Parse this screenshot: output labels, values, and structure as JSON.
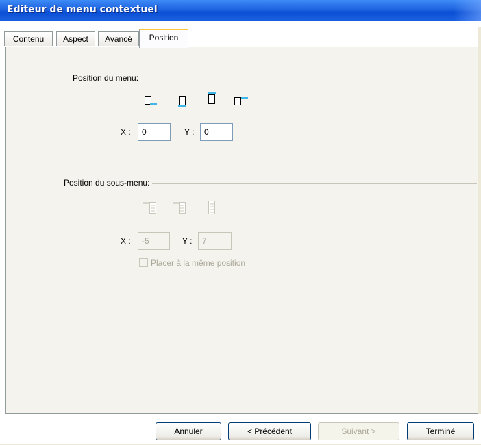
{
  "window": {
    "title": "Editeur de menu contextuel"
  },
  "tabs": [
    {
      "label": "Contenu"
    },
    {
      "label": "Aspect"
    },
    {
      "label": "Avancé"
    },
    {
      "label": "Position",
      "active": true
    }
  ],
  "menu_position": {
    "heading": "Position du menu:",
    "alignment_icons": [
      "align-bottom-right-icon",
      "align-bottom-icon",
      "align-top-icon",
      "align-right-top-icon"
    ],
    "x_label": "X :",
    "x_value": "0",
    "y_label": "Y :",
    "y_value": "0"
  },
  "submenu_position": {
    "heading": "Position du sous-menu:",
    "alignment_icons": [
      "submenu-align-top-right-icon",
      "submenu-align-top-icon",
      "submenu-align-full-icon"
    ],
    "x_label": "X :",
    "x_value": "-5",
    "y_label": "Y :",
    "y_value": "7",
    "same_position_label": "Placer à la même position",
    "same_position_checked": false,
    "enabled": false
  },
  "buttons": {
    "cancel": "Annuler",
    "previous": "< Précédent",
    "next": "Suivant >",
    "finish": "Terminé"
  },
  "colors": {
    "accent": "#ffc83c",
    "titlebar": "#0a4fd4",
    "icon_highlight": "#3fb5e8"
  }
}
